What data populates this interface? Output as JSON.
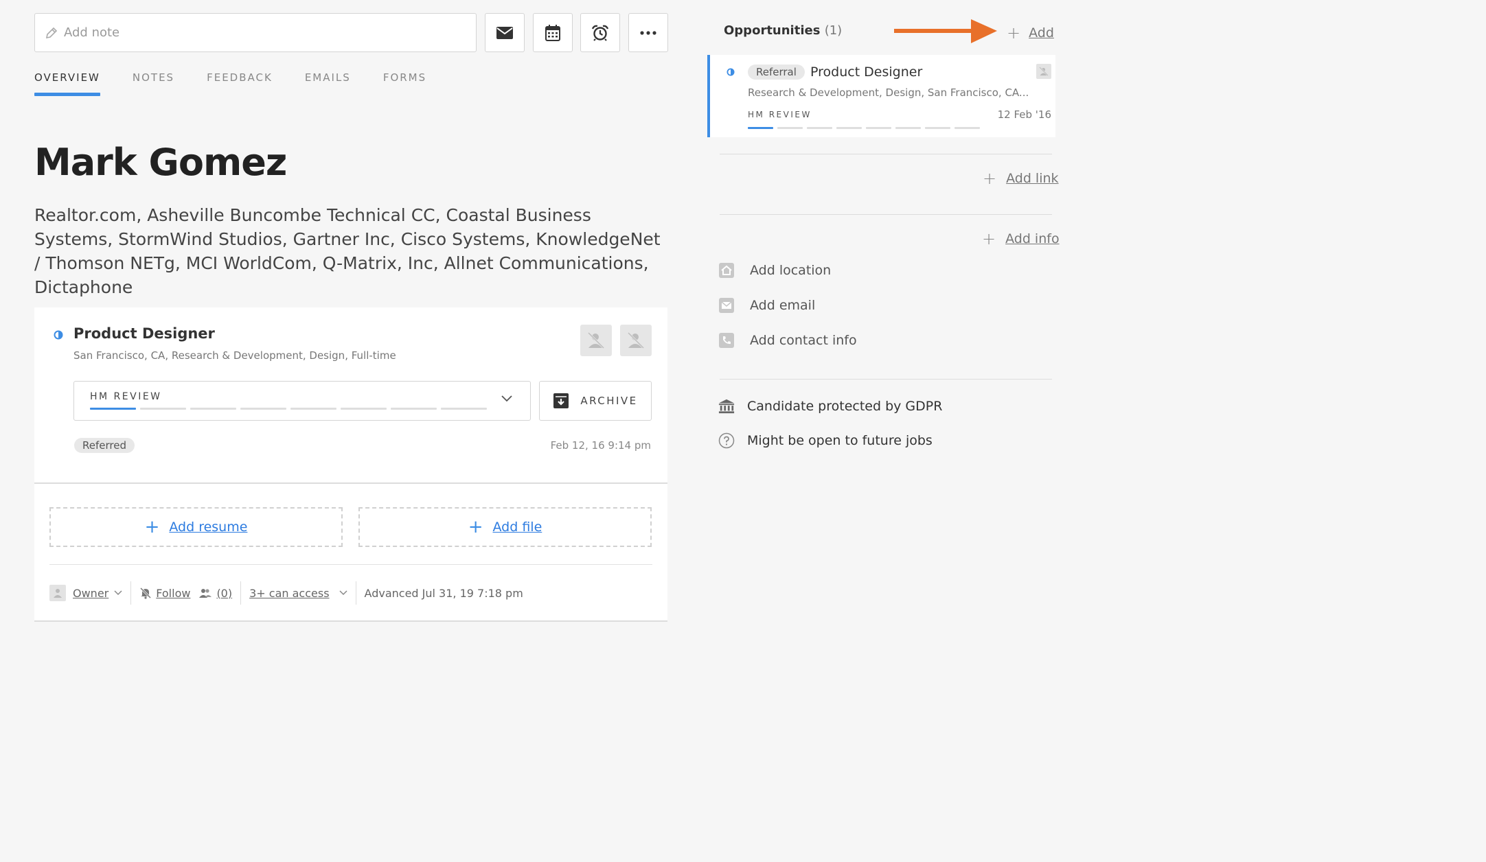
{
  "note": {
    "placeholder": "Add note"
  },
  "toolbar": {
    "icons": [
      "envelope-icon",
      "calendar-icon",
      "alarm-clock-icon",
      "more-icon"
    ]
  },
  "tabs": [
    {
      "label": "OVERVIEW",
      "active": true
    },
    {
      "label": "NOTES",
      "active": false
    },
    {
      "label": "FEEDBACK",
      "active": false
    },
    {
      "label": "EMAILS",
      "active": false
    },
    {
      "label": "FORMS",
      "active": false
    }
  ],
  "candidate": {
    "name": "Mark Gomez",
    "companies": "Realtor.com, Asheville Buncombe Technical CC, Coastal Business Systems, StormWind Studios, Gartner Inc, Cisco Systems, KnowledgeNet / Thomson NETg, MCI WorldCom, Q-Matrix, Inc, Allnet Communications, Dictaphone"
  },
  "opportunity_card": {
    "title": "Product Designer",
    "meta": "San Francisco, CA, Research & Development, Design, Full-time",
    "stage": "HM REVIEW",
    "stage_progress": {
      "current": 1,
      "total": 8
    },
    "archive_label": "ARCHIVE",
    "source_tag": "Referred",
    "date": "Feb 12, 16 9:14 pm",
    "add_resume": "Add resume",
    "add_file": "Add file",
    "footer": {
      "owner": "Owner",
      "follow": "Follow",
      "followers": "(0)",
      "access": "3+ can access",
      "advanced": "Advanced Jul 31, 19 7:18 pm"
    }
  },
  "sidebar": {
    "opportunities_label": "Opportunities",
    "opportunities_count": "(1)",
    "add_label": "Add",
    "opp": {
      "source": "Referral",
      "title": "Product Designer",
      "meta": "Research & Development, Design, San Francisco, CA...",
      "stage": "HM REVIEW",
      "date": "12 Feb '16",
      "stage_progress": {
        "current": 1,
        "total": 8
      }
    },
    "add_link": "Add link",
    "add_info": "Add info",
    "contact": [
      {
        "icon": "home-icon",
        "label": "Add location"
      },
      {
        "icon": "email-icon",
        "label": "Add email"
      },
      {
        "icon": "phone-icon",
        "label": "Add contact info"
      }
    ],
    "gdpr": "Candidate protected by GDPR",
    "future_jobs": "Might be open to future jobs"
  },
  "colors": {
    "accent": "#3d8de4",
    "link": "#2c7be0",
    "arrow": "#e8702a"
  }
}
